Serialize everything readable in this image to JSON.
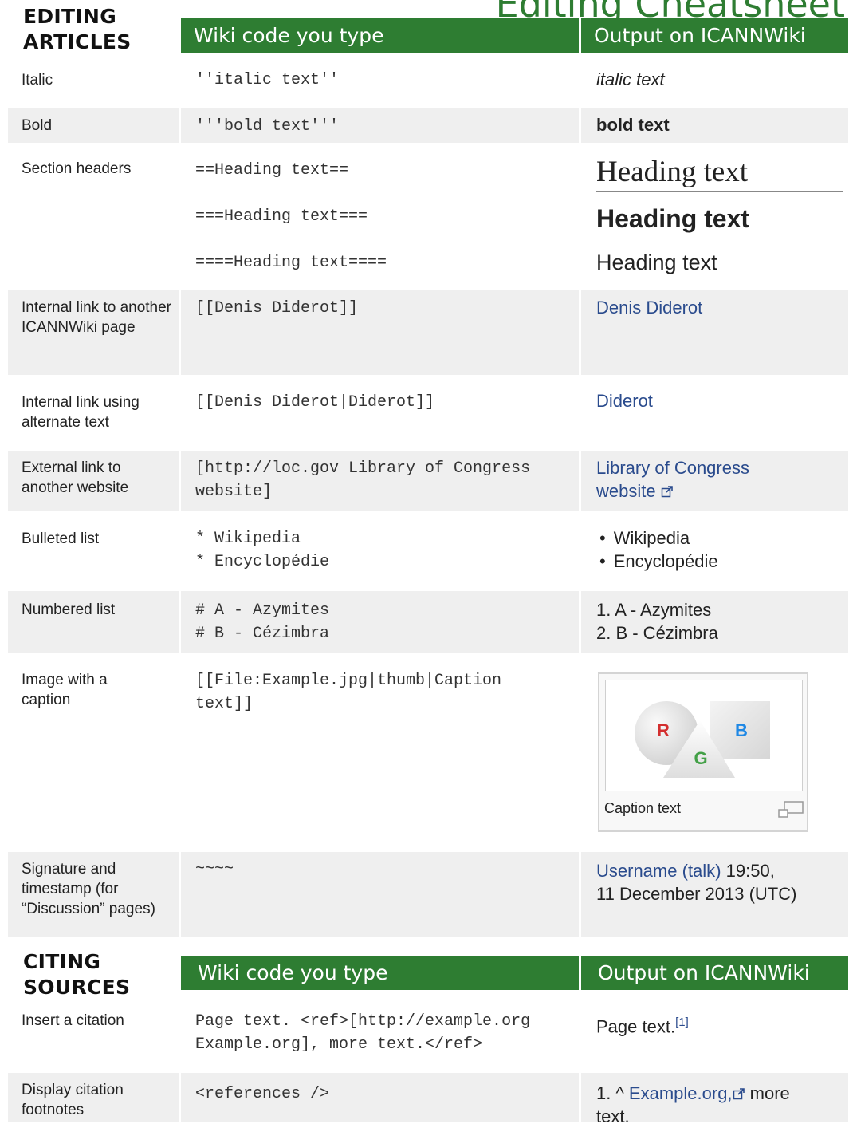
{
  "page_title": "Editing Cheatsheet",
  "editing": {
    "section_title_line1": "EDITING",
    "section_title_line2": "ARTICLES",
    "col_code": "Wiki code you type",
    "col_output": "Output on ICANNWiki",
    "italic": {
      "label": "Italic",
      "code": "''italic text''",
      "output": "italic text"
    },
    "bold": {
      "label": "Bold",
      "code": "'''bold text'''",
      "output": "bold text"
    },
    "headers": {
      "label": "Section headers",
      "code_h2": "==Heading text==",
      "code_h3": "===Heading text===",
      "code_h4": "====Heading text====",
      "out_h2": "Heading text",
      "out_h3": "Heading text",
      "out_h4": "Heading text"
    },
    "internal_link": {
      "label": "Internal link to another ICANNWiki page",
      "code": "[[Denis Diderot]]",
      "output": "Denis Diderot"
    },
    "alt_link": {
      "label": "Internal link using alternate text",
      "code": "[[Denis Diderot|Diderot]]",
      "output": "Diderot"
    },
    "external_link": {
      "label": "External link to another website",
      "code_line1": "[http://loc.gov Library of Congress",
      "code_line2": "website]",
      "output_line1": "Library of Congress",
      "output_line2": "website"
    },
    "bulleted": {
      "label": "Bulleted list",
      "code_line1": "* Wikipedia",
      "code_line2": "* Encyclopédie",
      "out_line1": "Wikipedia",
      "out_line2": "Encyclopédie"
    },
    "numbered": {
      "label": "Numbered list",
      "code_line1": "# A - Azymites",
      "code_line2": "# B - Cézimbra",
      "out_line1": "1. A - Azymites",
      "out_line2": "2. B - Cézimbra"
    },
    "image": {
      "label": "Image with a caption",
      "code_line1": "[[File:Example.jpg|thumb|Caption",
      "code_line2": "text]]",
      "caption": "Caption text",
      "letter_r": "R",
      "letter_g": "G",
      "letter_b": "B"
    },
    "signature": {
      "label": "Signature and timestamp (for “Discussion” pages)",
      "code": "~~~~",
      "out_user": "Username",
      "out_talk": "talk",
      "out_time": "19:50,",
      "out_date": "11 December 2013 (UTC)"
    }
  },
  "citing": {
    "section_title_line1": "CITING",
    "section_title_line2": "SOURCES",
    "col_code": "Wiki code you type",
    "col_output": "Output on ICANNWiki",
    "insert": {
      "label": "Insert a citation",
      "code_line1": "Page text. <ref>[http://example.org",
      "code_line2": "Example.org], more text.</ref>",
      "output": "Page text.",
      "sup": "[1]"
    },
    "display": {
      "label": "Display citation footnotes",
      "code": "<references />",
      "out_prefix": "1. ^",
      "out_link": "Example.org,",
      "out_rest": "more",
      "out_line2": "text."
    }
  },
  "colors": {
    "header_green": "#2e7d32",
    "band_gray": "#efefef",
    "link_blue": "#2a4b8d",
    "red": "#d32f2f",
    "green": "#43a047",
    "blue": "#1e88e5"
  }
}
